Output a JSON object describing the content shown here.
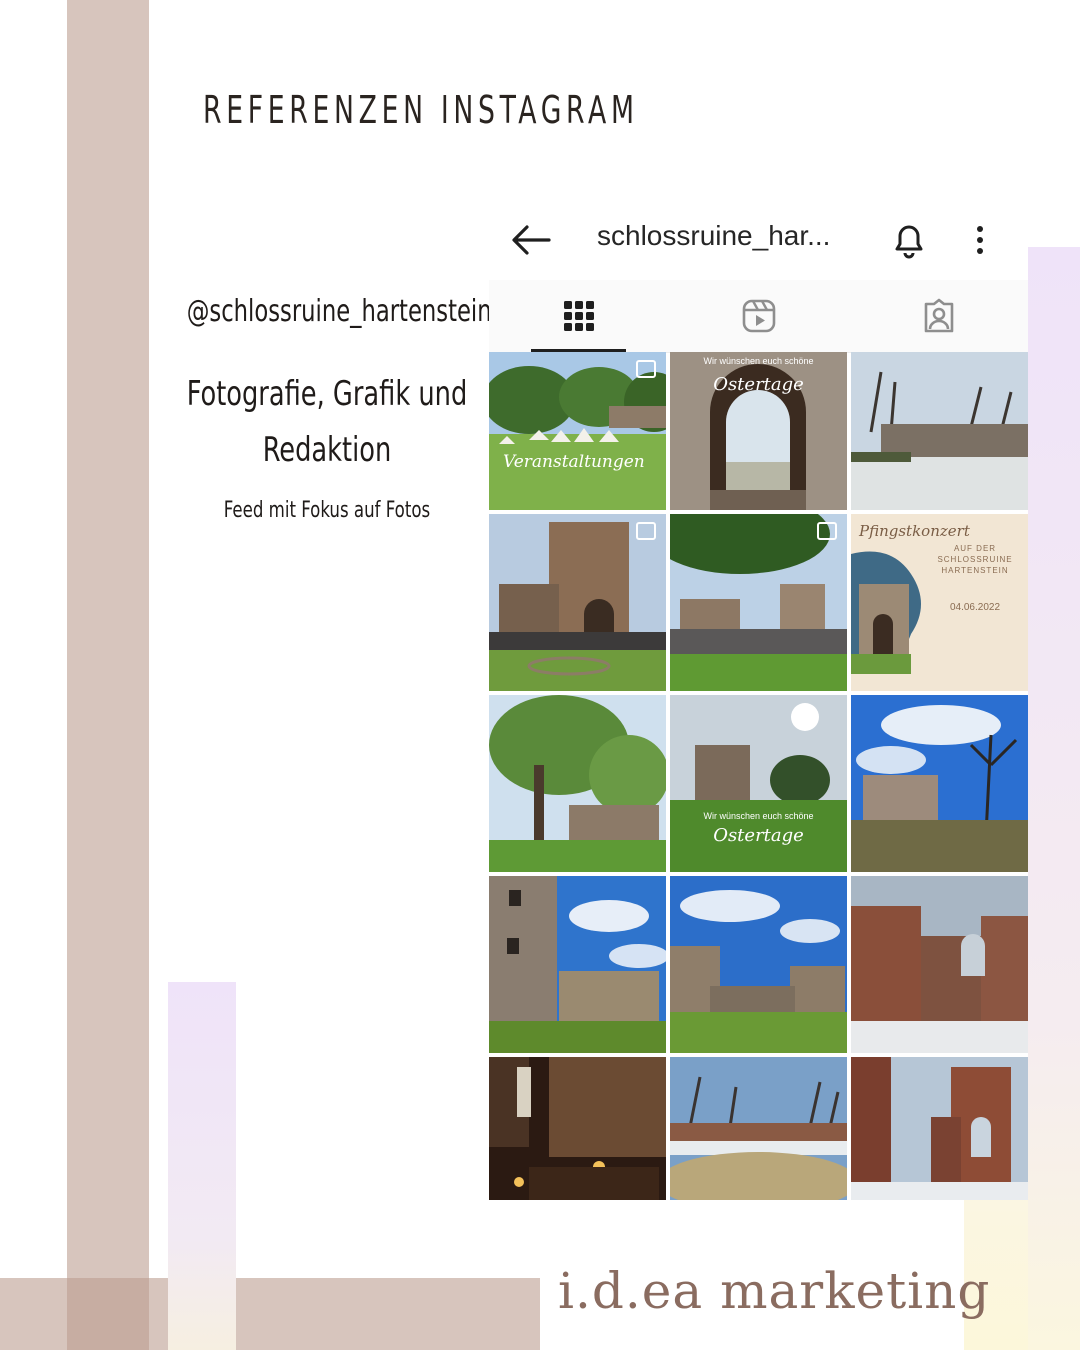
{
  "page": {
    "title": "REFERENZEN INSTAGRAM",
    "handle": "@schlossruine_hartenstein",
    "services": "Fotografie, Grafik und Redaktion",
    "feed_note": "Feed mit Fokus auf Fotos",
    "brand": "i.d.ea marketing"
  },
  "colors": {
    "bar_mauve": "#d7c5bd",
    "bar_lilac": "#efe3f9",
    "bar_yellow": "#fbf6e2",
    "brand_text": "#8a6c60"
  },
  "instagram": {
    "username": "schlossruine_har...",
    "icons": {
      "back": "arrow-left-icon",
      "bell": "bell-icon",
      "more": "more-vertical-icon"
    },
    "tabs": [
      {
        "name": "grid",
        "icon": "grid-icon",
        "active": true
      },
      {
        "name": "reels",
        "icon": "reels-icon",
        "active": false
      },
      {
        "name": "tagged",
        "icon": "tagged-icon",
        "active": false
      }
    ],
    "posts": [
      {
        "overlay": "Veranstaltungen",
        "multi": true
      },
      {
        "overlay_top": "Wir wünschen euch schöne",
        "overlay": "Ostertage"
      },
      {
        "overlay": ""
      },
      {
        "overlay": "",
        "multi": true
      },
      {
        "overlay": "",
        "multi": true
      },
      {
        "heading": "Pfingstkonzert",
        "sub1": "AUF DER",
        "sub2": "SCHLOSSRUINE",
        "sub3": "HARTENSTEIN",
        "date": "04.06.2022"
      },
      {
        "overlay": ""
      },
      {
        "overlay_top": "Wir wünschen euch schöne",
        "overlay": "Ostertage"
      },
      {
        "overlay": ""
      },
      {
        "overlay": ""
      },
      {
        "overlay": ""
      },
      {
        "overlay": ""
      },
      {
        "overlay": ""
      },
      {
        "overlay": ""
      },
      {
        "overlay": ""
      }
    ]
  }
}
